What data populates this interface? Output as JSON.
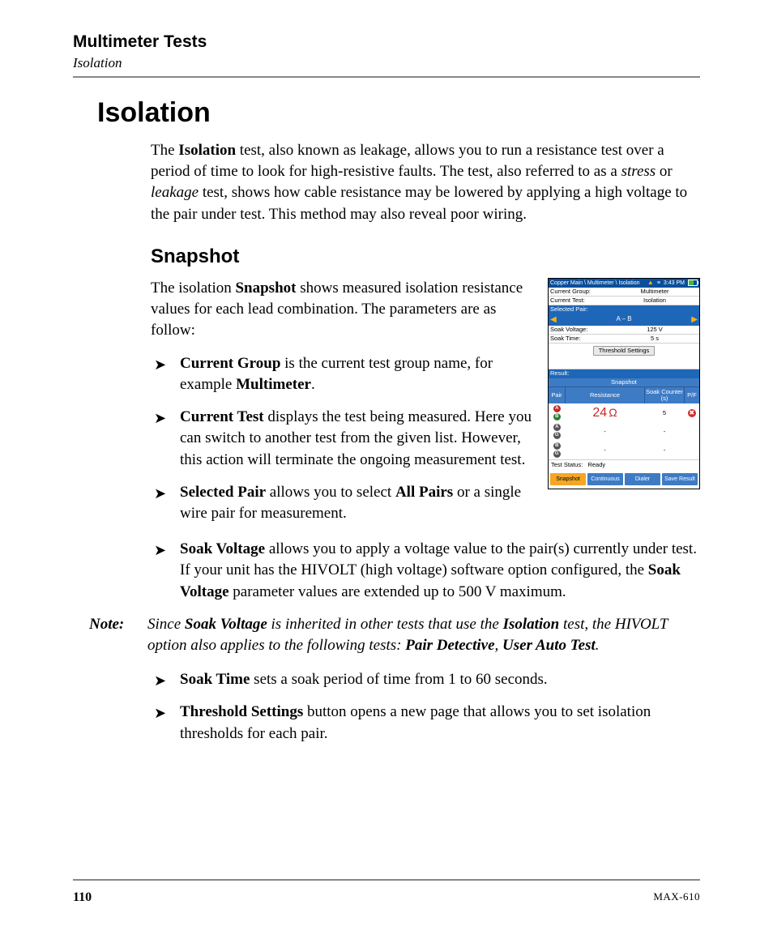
{
  "header": {
    "chapter": "Multimeter Tests",
    "subchapter": "Isolation"
  },
  "section_title": "Isolation",
  "intro": {
    "pre": "The ",
    "bold1": "Isolation",
    "mid1": " test, also known as leakage, allows you to run a resistance test over a period of time to look for high-resistive faults. The test, also referred to as a ",
    "it1": "stress",
    "mid2": " or ",
    "it2": "leakage",
    "post": " test, shows how cable resistance may be lowered by applying a high voltage to the pair under test. This method may also reveal poor wiring."
  },
  "subsection_title": "Snapshot",
  "snapshot_intro": {
    "pre": "The isolation ",
    "bold": "Snapshot",
    "post": " shows measured isolation resistance values for each lead combination. The parameters are as follow:"
  },
  "bullets_left": {
    "b1": {
      "bold": "Current Group",
      "mid": " is the current test group name, for example ",
      "bold2": "Multimeter",
      "post": "."
    },
    "b2": {
      "bold": "Current Test",
      "post": " displays the test being measured. Here you can switch to another test from the given list. However, this action will terminate the ongoing measurement test."
    },
    "b3": {
      "bold": "Selected Pair",
      "mid": " allows you to select ",
      "bold2": "All Pairs",
      "post": " or a single wire pair for measurement."
    }
  },
  "bullets_full": {
    "b4": {
      "bold": "Soak Voltage",
      "mid": " allows you to apply a voltage value to the pair(s) currently under test. If your unit has the HIVOLT (high voltage) software option configured, the ",
      "bold2": "Soak Voltage",
      "post": " parameter values are extended up to 500 V maximum."
    }
  },
  "note": {
    "label": "Note:",
    "pre": "Since ",
    "b1": "Soak Voltage",
    "mid1": " is inherited in other tests that use the ",
    "b2": "Isolation",
    "mid2": " test, the HIVOLT option also applies to the following tests: ",
    "b3": "Pair Detective",
    "sep": ", ",
    "b4": "User Auto Test",
    "post": "."
  },
  "bullets_after": {
    "b5": {
      "bold": "Soak Time",
      "post": " sets a soak period of time from 1 to 60 seconds."
    },
    "b6": {
      "bold": "Threshold Settings",
      "post": " button opens a new page that allows you to set isolation thresholds for each pair."
    }
  },
  "footer": {
    "page": "110",
    "model": "MAX-610"
  },
  "device": {
    "breadcrumb": "Copper Main \\ Multimeter \\ Isolation",
    "time": "3:43 PM",
    "current_group_k": "Current Group:",
    "current_group_v": "Multimeter",
    "current_test_k": "Current Test:",
    "current_test_v": "Isolation",
    "selected_pair_label": "Selected Pair:",
    "selected_pair_value": "A – B",
    "soak_voltage_k": "Soak Voltage:",
    "soak_voltage_v": "125 V",
    "soak_time_k": "Soak Time:",
    "soak_time_v": "5 s",
    "threshold_btn": "Threshold Settings",
    "result_label": "Result:",
    "snapshot_header": "Snapshot",
    "col_pair": "Pair",
    "col_resistance": "Resistance",
    "col_soak": "Soak Counter (s)",
    "col_pf": "P/F",
    "row1": {
      "value": "24",
      "unit": "Ω",
      "soak": "5"
    },
    "dash": "-",
    "status_k": "Test Status:",
    "status_v": "Ready",
    "buttons": {
      "b1": "Snapshot",
      "b2": "Continuous",
      "b3": "Dialer",
      "b4": "Save Result"
    }
  }
}
